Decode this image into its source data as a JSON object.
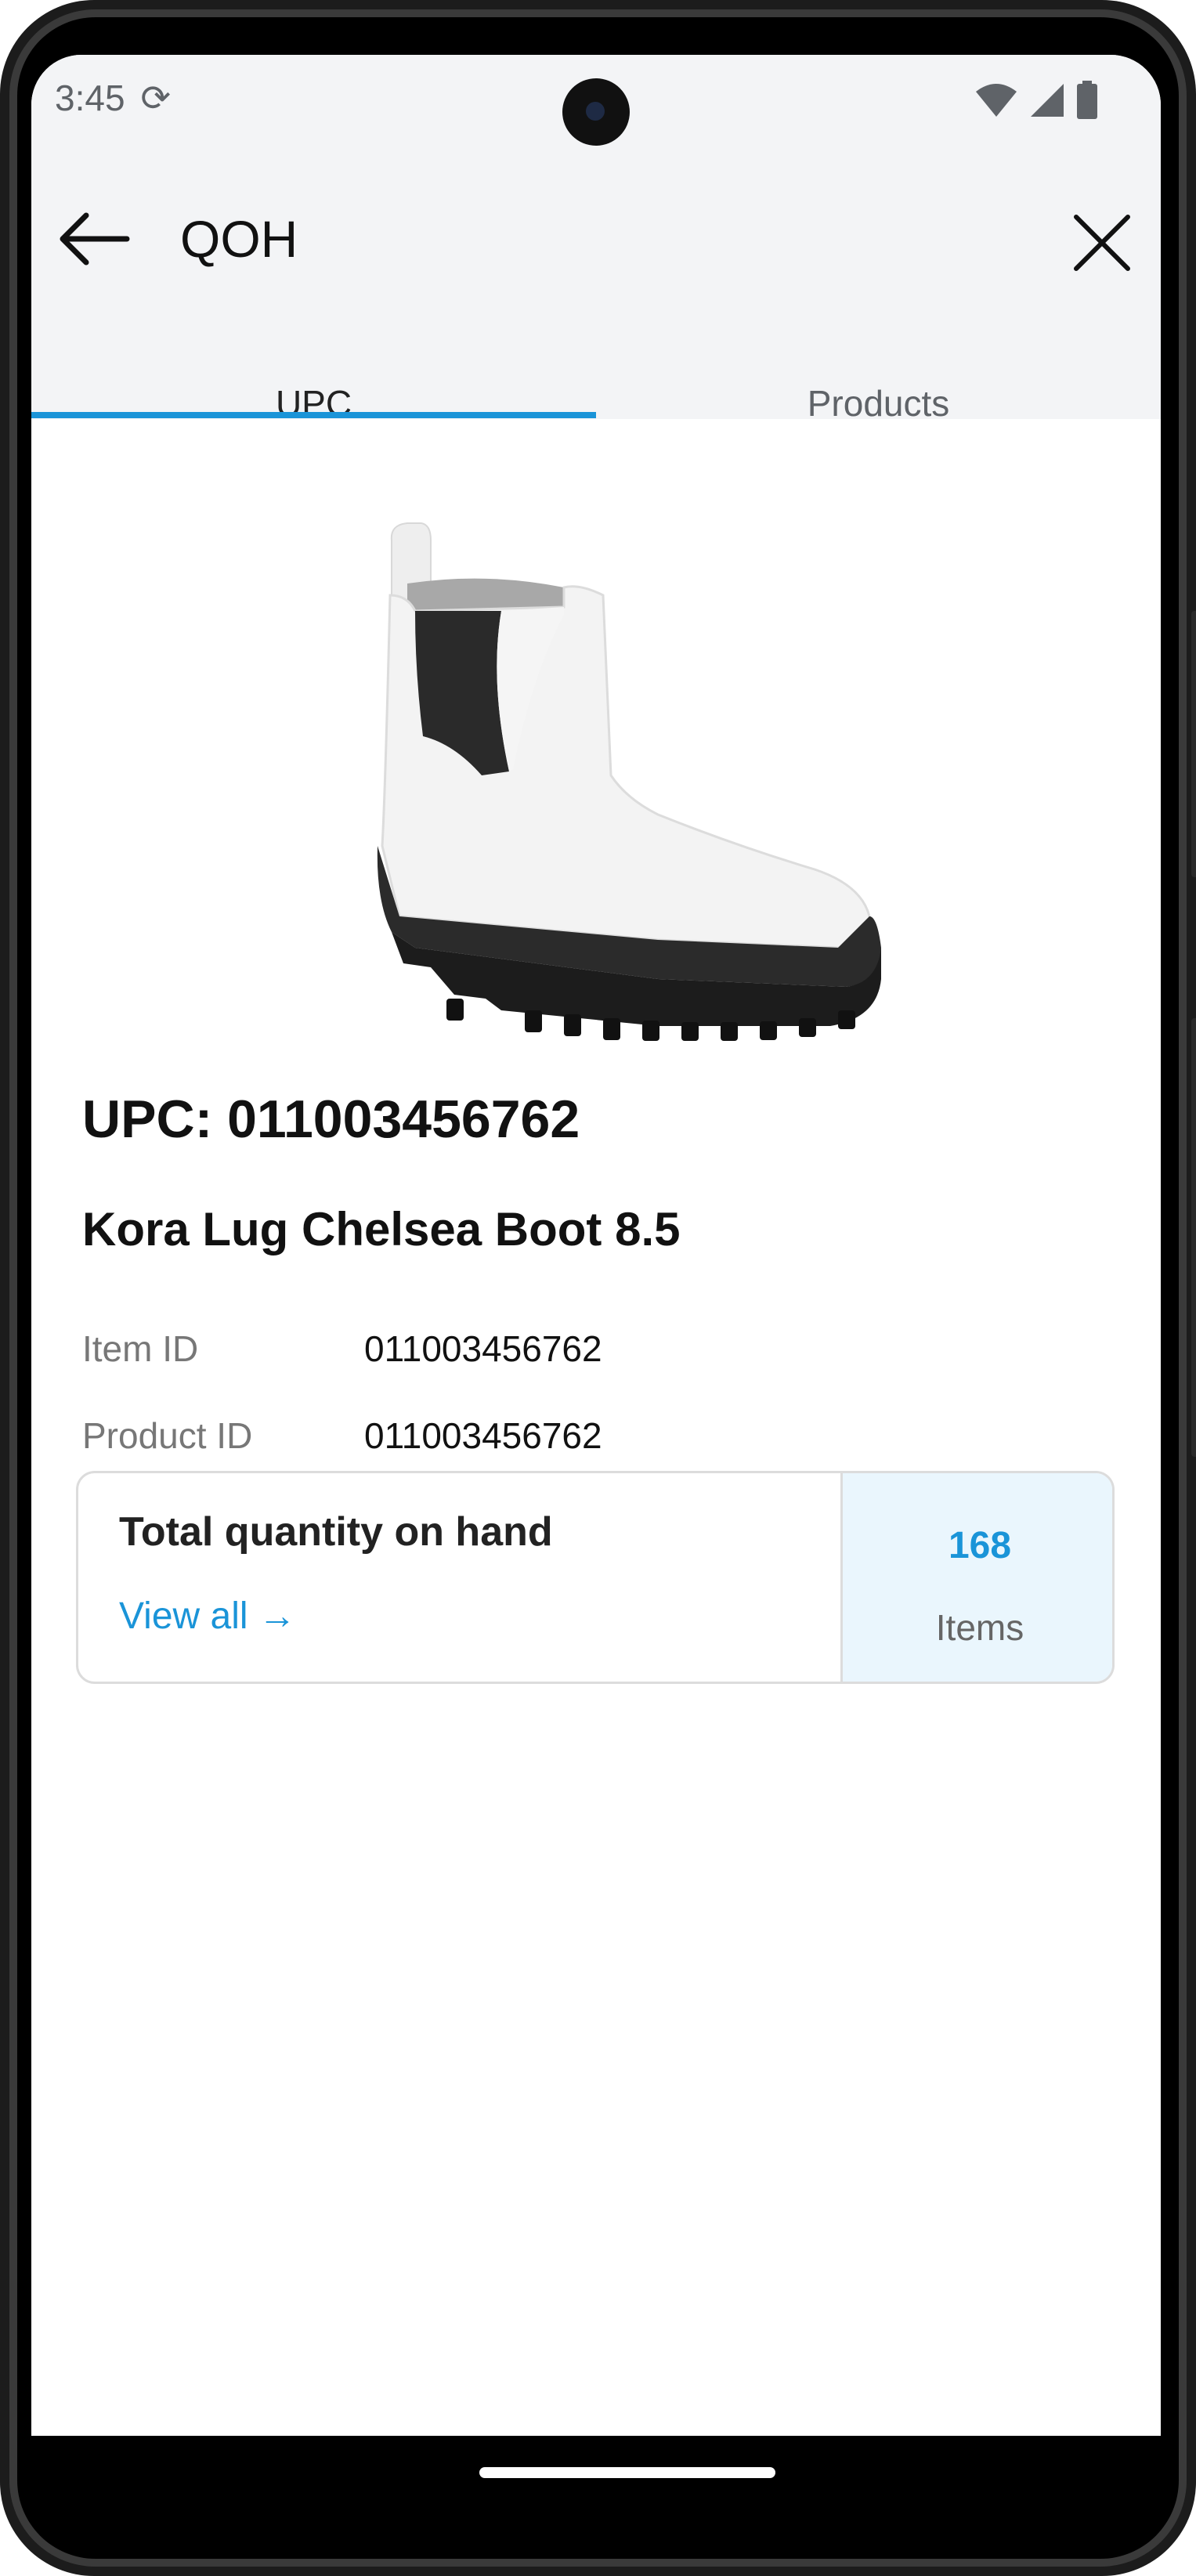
{
  "status_bar": {
    "time": "3:45"
  },
  "toolbar": {
    "title": "QOH"
  },
  "tabs": [
    {
      "label": "UPC",
      "active": true
    },
    {
      "label": "Products",
      "active": false
    }
  ],
  "product": {
    "upc_heading": "UPC: 011003456762",
    "name": "Kora Lug Chelsea Boot 8.5",
    "details": [
      {
        "label": "Item ID",
        "value": "011003456762"
      },
      {
        "label": "Product ID",
        "value": "011003456762"
      }
    ]
  },
  "quantity_card": {
    "title": "Total quantity on hand",
    "link_label": "View all →",
    "count": "168",
    "unit": "Items"
  },
  "colors": {
    "accent": "#1a94d8",
    "appbar_bg": "#f3f4f6",
    "quantity_bg": "#eaf6fd"
  },
  "icons": [
    "sync-icon",
    "wifi-icon",
    "signal-icon",
    "battery-icon",
    "back-arrow-icon",
    "close-icon"
  ]
}
